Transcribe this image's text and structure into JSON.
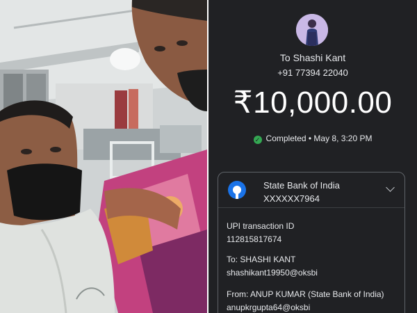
{
  "payment": {
    "recipient_label": "To Shashi Kant",
    "recipient_phone": "+91 77394 22040",
    "amount": "₹10,000.00",
    "status": "Completed • May 8, 3:20 PM",
    "status_color": "#34a853",
    "bank": {
      "name": "State Bank of India",
      "account": "XXXXXX7964",
      "logo_icon": "sbi-logo-icon"
    },
    "details": {
      "upi_label": "UPI transaction ID",
      "upi_value": "112815817674",
      "to_label": "To: SHASHI  KANT",
      "to_value": "shashikant19950@oksbi",
      "from_label": "From: ANUP  KUMAR (State Bank of India)",
      "from_value": "anupkrgupta64@oksbi"
    }
  },
  "colors": {
    "panel_bg": "#202124",
    "text": "#e8eaed"
  }
}
